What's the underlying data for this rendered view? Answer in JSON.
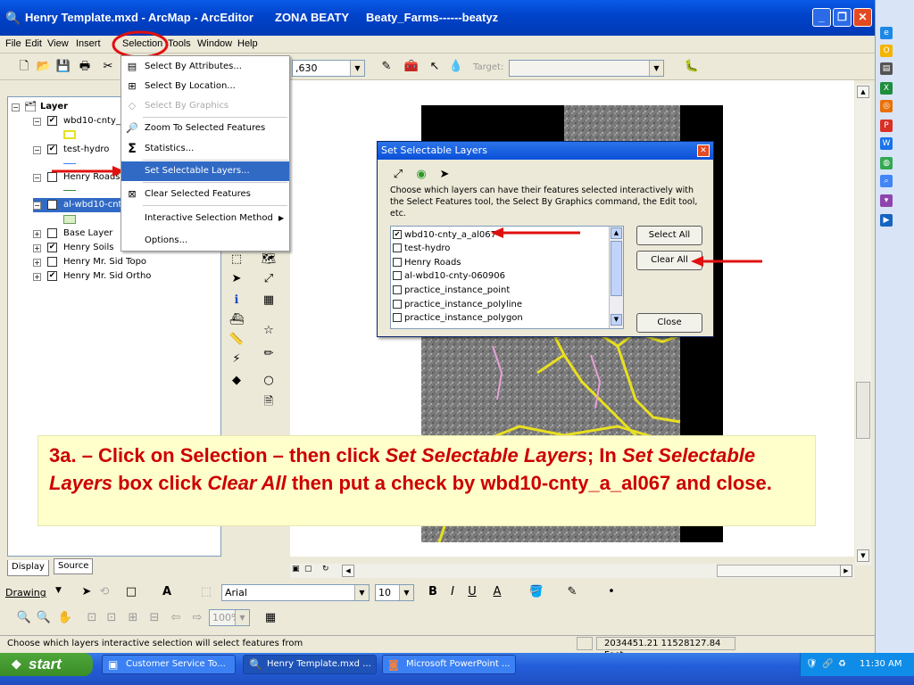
{
  "window": {
    "title": "Henry Template.mxd - ArcMap - ArcEditor",
    "user": "ZONA BEATY",
    "context": "Beaty_Farms------beatyz"
  },
  "menubar": {
    "items": [
      "File",
      "Edit",
      "View",
      "Insert",
      "Selection",
      "Tools",
      "Window",
      "Help"
    ]
  },
  "toolbar": {
    "scale_value": ",630",
    "target_label": "Target:"
  },
  "toc": {
    "layers": [
      {
        "label": "Layer",
        "checked": null
      },
      {
        "label": "wbd10-cnty_",
        "checked": true
      },
      {
        "label": "test-hydro",
        "checked": true
      },
      {
        "label": "Henry Roads",
        "checked": false
      },
      {
        "label": "al-wbd10-cnt",
        "checked": false
      },
      {
        "label": "Base Layer",
        "checked": false
      },
      {
        "label": "Henry Soils",
        "checked": true
      },
      {
        "label": "Henry Mr. Sid Topo",
        "checked": false
      },
      {
        "label": "Henry Mr. Sid Ortho",
        "checked": true
      }
    ],
    "tabs": [
      "Display",
      "Source"
    ]
  },
  "selection_menu": {
    "items": [
      {
        "label": "Select By Attributes...",
        "enabled": true
      },
      {
        "label": "Select By Location...",
        "enabled": true
      },
      {
        "label": "Select By Graphics",
        "enabled": false
      },
      {
        "label": "Zoom To Selected Features",
        "enabled": true
      },
      {
        "label": "Statistics...",
        "enabled": true
      },
      {
        "label": "Set Selectable Layers...",
        "enabled": true,
        "highlighted": true
      },
      {
        "label": "Clear Selected Features",
        "enabled": true
      },
      {
        "label": "Interactive Selection Method",
        "enabled": true
      },
      {
        "label": "Options...",
        "enabled": true
      }
    ]
  },
  "dialog": {
    "title": "Set Selectable Layers",
    "description": "Choose which layers can have their features selected interactively with the Select Features tool, the Select By Graphics command, the Edit tool, etc.",
    "layers": [
      {
        "label": "wbd10-cnty_a_al067",
        "checked": true
      },
      {
        "label": "test-hydro",
        "checked": false
      },
      {
        "label": "Henry Roads",
        "checked": false
      },
      {
        "label": "al-wbd10-cnty-060906",
        "checked": false
      },
      {
        "label": "practice_instance_point",
        "checked": false
      },
      {
        "label": "practice_instance_polyline",
        "checked": false
      },
      {
        "label": "practice_instance_polygon",
        "checked": false
      }
    ],
    "select_all": "Select All",
    "clear_all": "Clear All",
    "close": "Close"
  },
  "instruction": {
    "p1": "3a. – Click on Selection – then click ",
    "i1": "Set Selectable Layers",
    "p2": ";  In ",
    "i2": "Set Selectable Layers",
    "p3": " box click ",
    "i3": "Clear All",
    "p4": " then put a check by wbd10-cnty_a_al067 and close."
  },
  "drawing_toolbar": {
    "drawing_label": "Drawing",
    "font_name": "Arial",
    "font_size": "10",
    "zoom": "100%"
  },
  "status": {
    "message": "Choose which layers interactive selection will select features from",
    "coordinates": "2034451.21  11528127.84 Feet"
  },
  "taskbar": {
    "start": "start",
    "tasks": [
      "Customer Service To...",
      "Henry Template.mxd ...",
      "Microsoft PowerPoint ..."
    ],
    "clock": "11:30 AM"
  },
  "colors": {
    "accent": "#316ac5",
    "annotation_red": "#e01010",
    "map_boundary": "#e8e020",
    "instruction_text": "#cc0000",
    "instruction_bg": "#ffffcc"
  }
}
